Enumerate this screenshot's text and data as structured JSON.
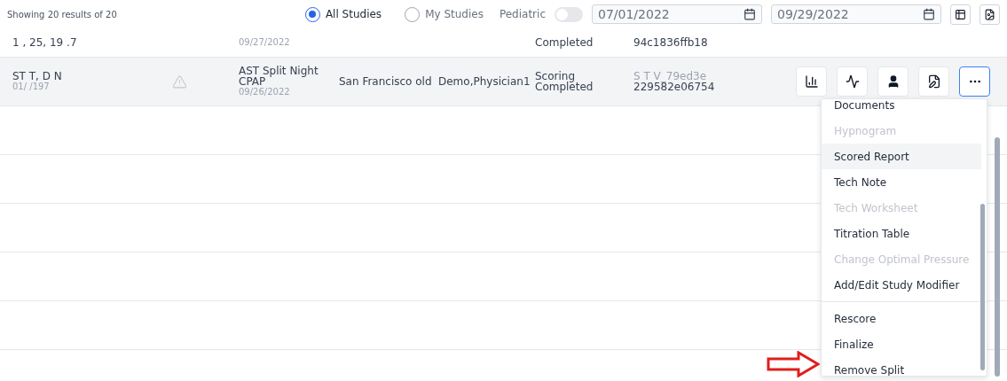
{
  "results_summary": "Showing 20 results of 20",
  "filters": {
    "scope": [
      {
        "label": "All Studies",
        "selected": true
      },
      {
        "label": "My Studies",
        "selected": false
      }
    ],
    "pediatric": {
      "label": "Pediatric",
      "on": false
    },
    "date_from": "07/01/2022",
    "date_to": "09/29/2022"
  },
  "rows": [
    {
      "patient": "1 , 25, 19 .7",
      "study_date": "09/27/2022",
      "status": "Completed",
      "study_id": "94c1836ffb18",
      "selected": false
    },
    {
      "patient": "ST T, D N",
      "dob": "01/ /197",
      "study_type": "AST Split Night CPAP",
      "study_date": "09/26/2022",
      "location": "San Francisco old",
      "physician": "Demo,Physician1",
      "status": "Scoring Completed",
      "study_id": "S T V_79ed3e",
      "study_id_2": "229582e06754",
      "selected": true
    }
  ],
  "menu": {
    "groups": [
      [
        {
          "label": "Documents",
          "disabled": false,
          "selected": false
        },
        {
          "label": "Hypnogram",
          "disabled": true,
          "selected": false
        },
        {
          "label": "Scored Report",
          "disabled": false,
          "selected": true
        },
        {
          "label": "Tech Note",
          "disabled": false,
          "selected": false
        },
        {
          "label": "Tech Worksheet",
          "disabled": true,
          "selected": false
        },
        {
          "label": "Titration Table",
          "disabled": false,
          "selected": false
        },
        {
          "label": "Change Optimal Pressure",
          "disabled": true,
          "selected": false
        },
        {
          "label": "Add/Edit Study Modifier",
          "disabled": false,
          "selected": false
        }
      ],
      [
        {
          "label": "Rescore",
          "disabled": false,
          "selected": false
        },
        {
          "label": "Finalize",
          "disabled": false,
          "selected": false
        },
        {
          "label": "Remove Split",
          "disabled": false,
          "selected": false
        }
      ]
    ]
  }
}
